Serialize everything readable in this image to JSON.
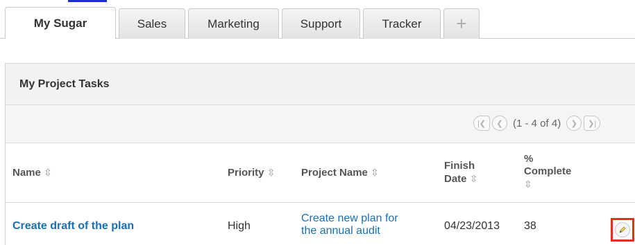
{
  "tabs": [
    {
      "label": "My Sugar",
      "active": true
    },
    {
      "label": "Sales"
    },
    {
      "label": "Marketing"
    },
    {
      "label": "Support"
    },
    {
      "label": "Tracker"
    },
    {
      "label": "+"
    }
  ],
  "dashlet": {
    "title": "My Project Tasks",
    "pager": {
      "text": "(1 - 4 of 4)"
    },
    "columns": {
      "name": "Name",
      "priority": "Priority",
      "project_name": "Project Name",
      "finish_date_line1": "Finish",
      "finish_date_line2": "Date",
      "pct_line1": "%",
      "pct_line2": "Complete",
      "sort_icon": "⇳"
    },
    "rows": [
      {
        "name": "Create draft of the plan",
        "priority": "High",
        "project_line1": "Create new plan for",
        "project_line2": "the annual audit",
        "finish_date": "04/23/2013",
        "pct": "38"
      }
    ]
  },
  "icons": {
    "first": "first-page-icon",
    "prev": "prev-page-icon",
    "next": "next-page-icon",
    "last": "last-page-icon",
    "edit": "pencil-icon"
  },
  "colors": {
    "link": "#1a6eb5",
    "highlight": "#e0301e"
  }
}
